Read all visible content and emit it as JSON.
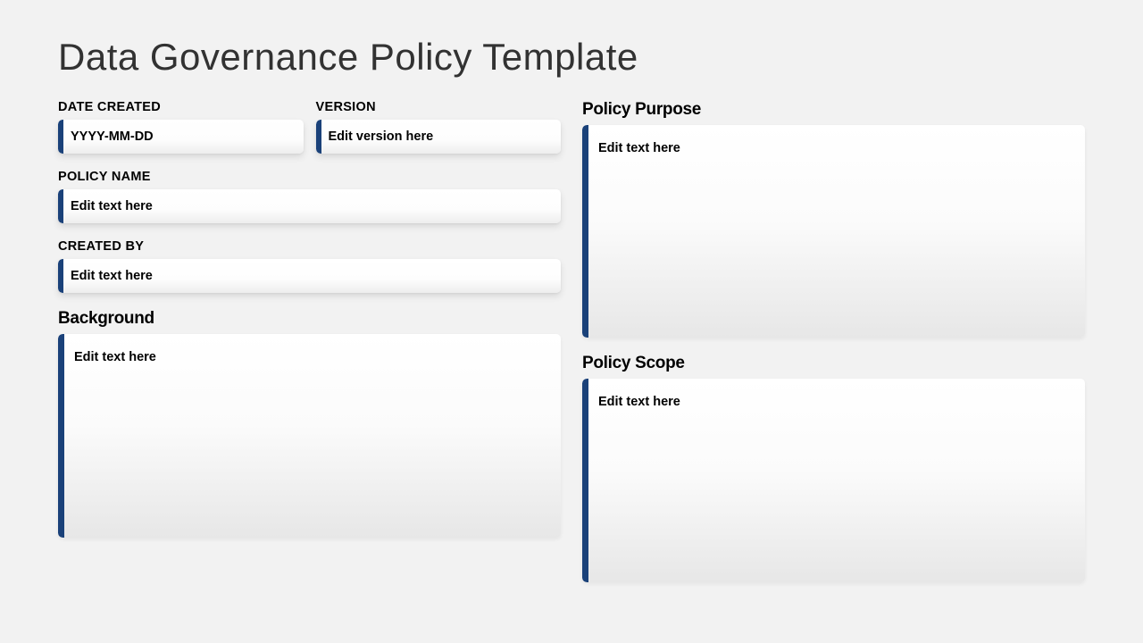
{
  "title": "Data Governance Policy Template",
  "left": {
    "date_created": {
      "label": "DATE CREATED",
      "value": "YYYY-MM-DD"
    },
    "version": {
      "label": "VERSION",
      "value": "Edit version here"
    },
    "policy_name": {
      "label": "POLICY NAME",
      "value": "Edit text here"
    },
    "created_by": {
      "label": "CREATED BY",
      "value": "Edit text here"
    },
    "background": {
      "heading": "Background",
      "value": "Edit text here"
    }
  },
  "right": {
    "purpose": {
      "heading": "Policy Purpose",
      "value": "Edit text here"
    },
    "scope": {
      "heading": "Policy Scope",
      "value": "Edit text here"
    }
  },
  "colors": {
    "accent": "#1a4179",
    "page_bg": "#f2f2f2"
  }
}
